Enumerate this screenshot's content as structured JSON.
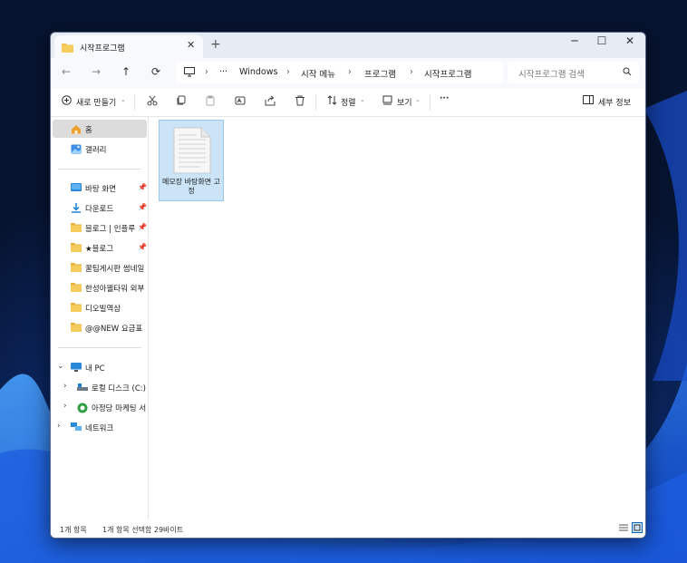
{
  "window": {
    "tab_title": "시작프로그램",
    "tab_close": "✕",
    "new_tab": "+",
    "minimize": "─",
    "maximize": "☐",
    "close": "✕"
  },
  "nav": {
    "back": "←",
    "forward": "→",
    "up": "↑",
    "refresh": "⟳",
    "more": "···",
    "sep": "›",
    "breadcrumb": [
      "Windows",
      "시작 메뉴",
      "프로그램",
      "시작프로그램"
    ],
    "search_placeholder": "시작프로그램 검색"
  },
  "toolbar": {
    "new_label": "새로 만들기",
    "sort_label": "정렬",
    "view_label": "보기",
    "more": "···",
    "details_label": "세부 정보"
  },
  "sidebar": {
    "home": "홈",
    "gallery": "갤러리",
    "pinned": [
      {
        "label": "바탕 화면",
        "icon": "desktop-icon",
        "pin": true
      },
      {
        "label": "다운로드",
        "icon": "download-icon",
        "pin": true
      },
      {
        "label": "블로그 | 인플루",
        "icon": "folder-icon",
        "pin": true
      },
      {
        "label": "★블로그",
        "icon": "folder-icon",
        "pin": true
      },
      {
        "label": "꿀팁게시판 썸네일",
        "icon": "folder-icon",
        "pin": false
      },
      {
        "label": "한성아웰타워 외부",
        "icon": "folder-icon",
        "pin": false
      },
      {
        "label": "디오빌역삼",
        "icon": "folder-icon",
        "pin": false
      },
      {
        "label": "@@NEW 요금표",
        "icon": "folder-icon",
        "pin": false
      }
    ],
    "pin_glyph": "📌",
    "this_pc": "내 PC",
    "local_disk": "로컬 디스크 (C:)",
    "network_drive": "아정당 마케팅 서",
    "network": "네트워크"
  },
  "content": {
    "files": [
      {
        "name": "메모장 바탕화면 고정",
        "type": "text-file",
        "selected": true
      }
    ]
  },
  "status": {
    "item_count": "1개 항목",
    "selection": "1개 항목 선택함 29바이트"
  },
  "colors": {
    "accent": "#0067c0",
    "folder": "#f2c14e",
    "selection_bg": "#cce4f7"
  }
}
